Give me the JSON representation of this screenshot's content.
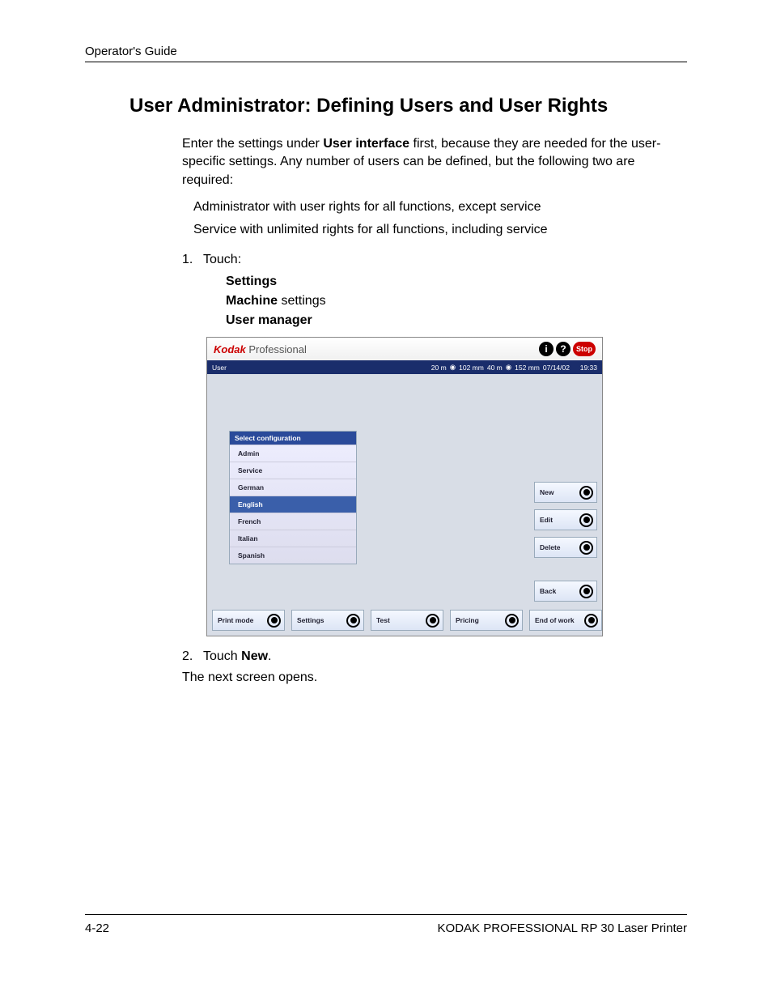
{
  "header": {
    "title": "Operator's Guide"
  },
  "h1": "User Administrator: Defining Users and User Rights",
  "intro": {
    "pre": "Enter the settings under ",
    "bold": "User interface",
    "post": " first, because they are needed for the user-specific settings. Any number of users can be defined, but the following two are required:"
  },
  "req1": "Administrator with user rights for all functions, except service",
  "req2": "Service with unlimited rights for all functions, including service",
  "step1": {
    "num": "1.",
    "label": "Touch:"
  },
  "touch": {
    "l1b": "Settings",
    "l2b": "Machine",
    "l2": " settings",
    "l3b": "User manager"
  },
  "shot": {
    "brand_k": "Kodak",
    "brand_p": " Professional",
    "stop": "Stop",
    "status_left": "User",
    "status_paper1": "20 m",
    "status_mm1": "102 mm",
    "status_paper2": "40 m",
    "status_mm2": "152 mm",
    "status_date": "07/14/02",
    "status_time": "19:33",
    "panel_h": "Select configuration",
    "items": [
      "Admin",
      "Service",
      "German",
      "English",
      "French",
      "Italian",
      "Spanish"
    ],
    "selected_index": 3,
    "rbtns": [
      "New",
      "Edit",
      "Delete",
      "Back"
    ],
    "bbtns": [
      "Print mode",
      "Settings",
      "Test",
      "Pricing",
      "End of work"
    ]
  },
  "step2": {
    "num": "2.",
    "pre": "Touch ",
    "b": "New",
    "post": "."
  },
  "after2": "The next screen opens.",
  "footer": {
    "left": "4-22",
    "right": "KODAK PROFESSIONAL RP 30 Laser Printer"
  }
}
